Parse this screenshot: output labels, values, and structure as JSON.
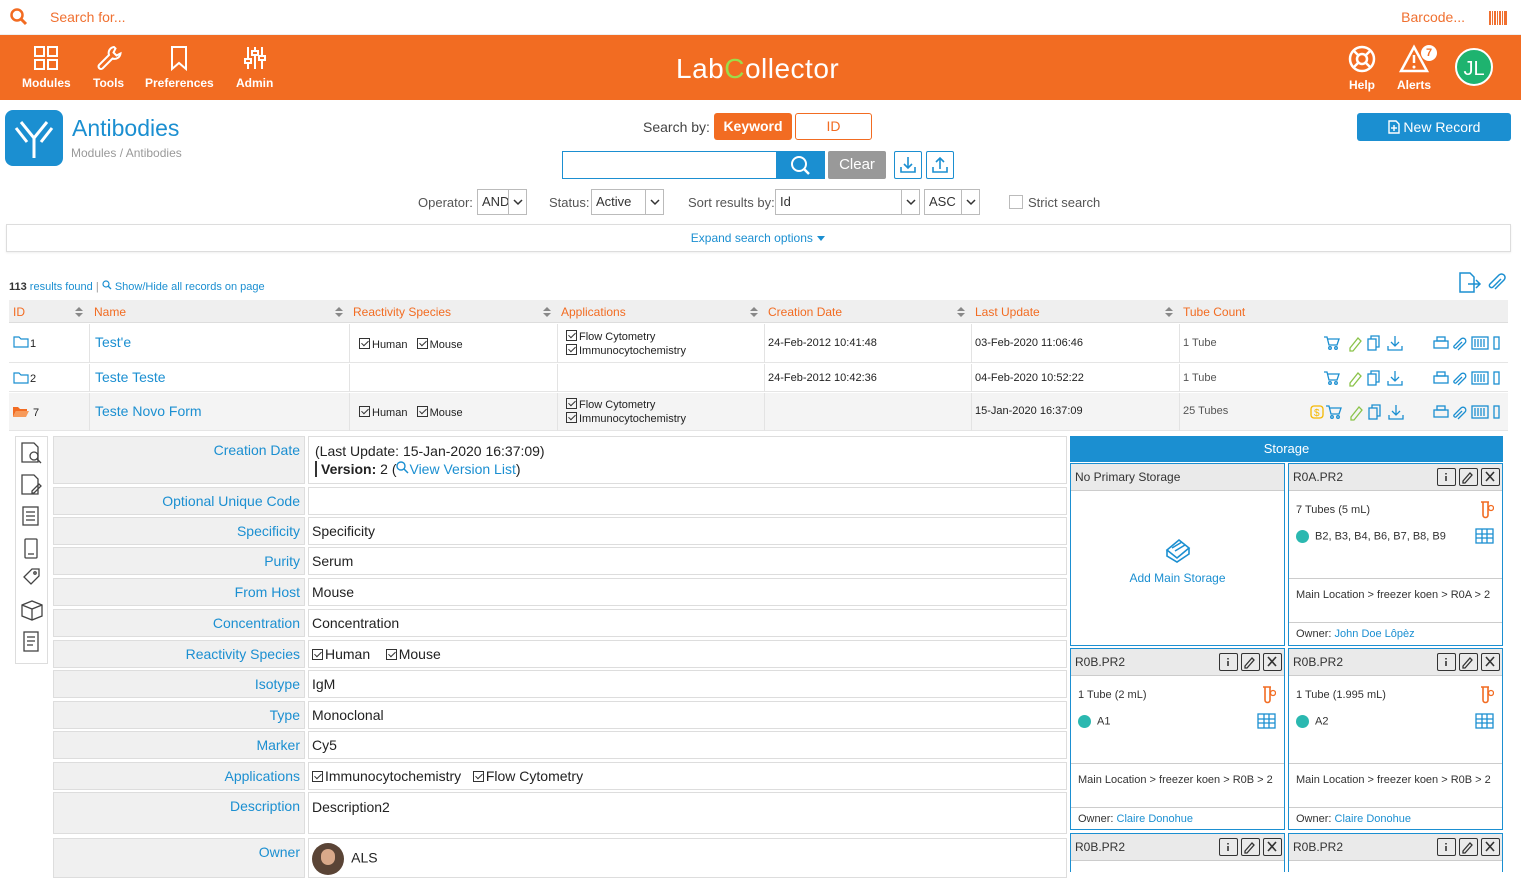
{
  "topbar": {
    "search_placeholder": "Search for...",
    "barcode_label": "Barcode..."
  },
  "nav": {
    "modules": "Modules",
    "tools": "Tools",
    "preferences": "Preferences",
    "admin": "Admin",
    "help": "Help",
    "alerts": "Alerts",
    "alerts_count": "7",
    "user_initials": "JL"
  },
  "logo": {
    "part1": "Lab",
    "part2": "C",
    "part3": "ollector"
  },
  "module": {
    "title": "Antibodies",
    "breadcrumb": "Modules / Antibodies"
  },
  "search": {
    "search_by_label": "Search by:",
    "keyword_btn": "Keyword",
    "id_btn": "ID",
    "clear_btn": "Clear",
    "new_record": "New Record"
  },
  "filters": {
    "operator_label": "Operator:",
    "operator_value": "AND",
    "status_label": "Status:",
    "status_value": "Active",
    "sort_label": "Sort results by:",
    "sort_value": "Id",
    "order_value": "ASC",
    "strict_label": "Strict search",
    "expand_label": "Expand search options"
  },
  "results": {
    "count": "113",
    "found_text": " results found",
    "showhide": "Show/Hide all records on page"
  },
  "table": {
    "headers": [
      "ID",
      "Name",
      "Reactivity Species",
      "Applications",
      "Creation Date",
      "Last Update",
      "Tube Count"
    ],
    "rows": [
      {
        "id": "1",
        "name": "Test'e",
        "species": [
          "Human",
          "Mouse"
        ],
        "apps": [
          "Flow Cytometry",
          "Immunocytochemistry"
        ],
        "created": "24-Feb-2012 10:41:48",
        "updated": "03-Feb-2020 11:06:46",
        "tubes": "1 Tube"
      },
      {
        "id": "2",
        "name": "Teste Teste",
        "species": [],
        "apps": [],
        "created": "24-Feb-2012 10:42:36",
        "updated": "04-Feb-2020 10:52:22",
        "tubes": "1 Tube"
      },
      {
        "id": "7",
        "name": "Teste Novo Form",
        "species": [
          "Human",
          "Mouse"
        ],
        "apps": [
          "Flow Cytometry",
          "Immunocytochemistry"
        ],
        "created": "",
        "updated": "15-Jan-2020 16:37:09",
        "tubes": "25 Tubes"
      }
    ]
  },
  "detail": {
    "creation_label": "Creation Date",
    "last_update": "(Last Update: 15-Jan-2020 16:37:09)",
    "version_label": "Version:",
    "version_value": " 2 (",
    "version_link": "View Version List",
    "version_close": ")",
    "fields": [
      {
        "label": "Optional Unique Code",
        "value": ""
      },
      {
        "label": "Specificity",
        "value": "Specificity"
      },
      {
        "label": "Purity",
        "value": "Serum"
      },
      {
        "label": "From Host",
        "value": "Mouse"
      },
      {
        "label": "Concentration",
        "value": "Concentration"
      },
      {
        "label": "Reactivity Species",
        "value": ""
      },
      {
        "label": "Isotype",
        "value": "IgM"
      },
      {
        "label": "Type",
        "value": "Monoclonal"
      },
      {
        "label": "Marker",
        "value": "Cy5"
      },
      {
        "label": "Applications",
        "value": ""
      },
      {
        "label": "Description",
        "value": "Description2"
      },
      {
        "label": "Owner",
        "value": "ALS"
      }
    ],
    "species_checks": [
      "Human",
      "Mouse"
    ],
    "app_checks": [
      "Immunocytochemistry",
      "Flow Cytometry"
    ]
  },
  "storage": {
    "title": "Storage",
    "no_primary": "No Primary Storage",
    "add_main": "Add Main Storage",
    "boxes": [
      {
        "name": "R0A.PR2",
        "tubes": "7 Tubes (5 mL)",
        "positions": "B2, B3, B4, B6, B7, B8, B9",
        "location": "Main Location > freezer koen > R0A > 2",
        "owner_label": "Owner:",
        "owner": "John Doe Lôpèz"
      },
      {
        "name": "R0B.PR2",
        "tubes": "1 Tube (2 mL)",
        "positions": "A1",
        "location": "Main Location > freezer koen > R0B > 2",
        "owner_label": "Owner:",
        "owner": "Claire Donohue"
      },
      {
        "name": "R0B.PR2",
        "tubes": "1 Tube (1.995 mL)",
        "positions": "A2",
        "location": "Main Location > freezer koen > R0B > 2",
        "owner_label": "Owner:",
        "owner": "Claire Donohue"
      },
      {
        "name": "R0B.PR2"
      },
      {
        "name": "R0B.PR2"
      }
    ]
  },
  "colors": {
    "orange": "#f26c22",
    "blue": "#1b8fd1",
    "green": "#1eb36f"
  }
}
